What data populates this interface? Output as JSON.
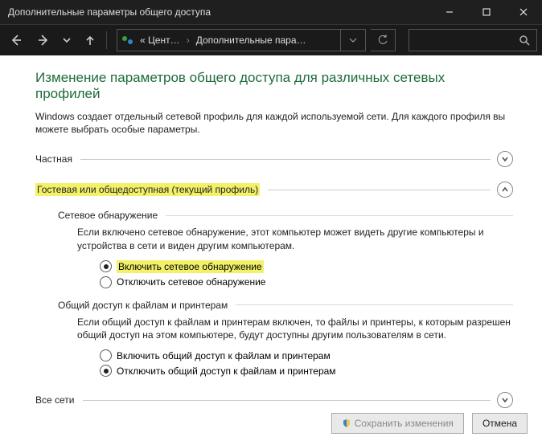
{
  "window": {
    "title": "Дополнительные параметры общего доступа"
  },
  "breadcrumb": {
    "part1": "« Цент…",
    "part2": "Дополнительные пара…"
  },
  "page": {
    "heading": "Изменение параметров общего доступа для различных сетевых профилей",
    "description": "Windows создает отдельный сетевой профиль для каждой используемой сети. Для каждого профиля вы можете выбрать особые параметры."
  },
  "sections": {
    "private": {
      "label": "Частная"
    },
    "guest": {
      "label": "Гостевая или общедоступная (текущий профиль)"
    },
    "all": {
      "label": "Все сети"
    }
  },
  "guest": {
    "discovery": {
      "heading": "Сетевое обнаружение",
      "text": "Если включено сетевое обнаружение, этот компьютер может видеть другие компьютеры и устройства в сети и виден другим компьютерам.",
      "on": "Включить сетевое обнаружение",
      "off": "Отключить сетевое обнаружение"
    },
    "sharing": {
      "heading": "Общий доступ к файлам и принтерам",
      "text": "Если общий доступ к файлам и принтерам включен, то файлы и принтеры, к которым разрешен общий доступ на этом компьютере, будут доступны другим пользователям в сети.",
      "on": "Включить общий доступ к файлам и принтерам",
      "off": "Отключить общий доступ к файлам и принтерам"
    }
  },
  "footer": {
    "save": "Сохранить изменения",
    "cancel": "Отмена"
  }
}
